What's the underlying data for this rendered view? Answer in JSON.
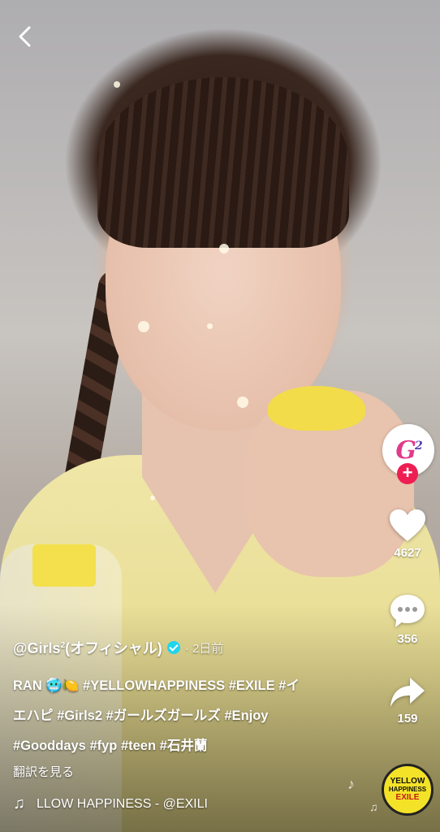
{
  "post": {
    "author": "@Girls",
    "author_sup": "2",
    "author_suffix": "(オフィシャル)",
    "date": "· 2日前",
    "caption": {
      "prefix": "RAN",
      "tags_line1": "#YELLOWHAPPINESS #EXILE #イ",
      "line2": "エハピ #Girls2 #ガールズガールズ #Enjoy",
      "line3": "#Gooddays #fyp #teen #石井蘭"
    },
    "translate": "翻訳を見る"
  },
  "music": {
    "track": "LLOW HAPPINESS - @EXILI"
  },
  "actions": {
    "likes": "4627",
    "comments": "356",
    "shares": "159"
  },
  "avatar": {
    "logo_text": "G",
    "logo_sup": "2",
    "follow_label": "+"
  },
  "disc": {
    "line1": "YELLOW",
    "line2": "HAPPINESS",
    "line3": "EXILE"
  },
  "icons": {
    "back": "chevron-left-icon",
    "like": "heart-icon",
    "comment": "comment-icon",
    "share": "share-icon",
    "music": "music-note-icon",
    "verified": "verified-badge-icon"
  },
  "colors": {
    "follow": "#ee1d52",
    "verified": "#20d5ec"
  }
}
